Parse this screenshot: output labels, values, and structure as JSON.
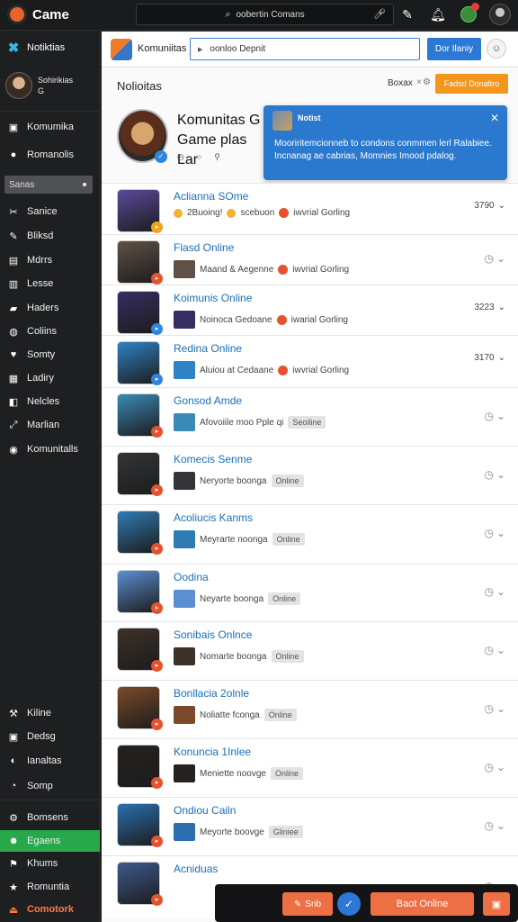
{
  "topbar": {
    "brand": "Came",
    "search_text": "oobertin Comans"
  },
  "sidebar": {
    "top_item": "Notiktias",
    "profile_name": "Sohirikias",
    "profile_sub": "G",
    "search_label": "Sanas",
    "items_a": [
      {
        "label": "Komumika",
        "icon": "home-icon"
      },
      {
        "label": "Romanolis",
        "icon": "globe-icon"
      }
    ],
    "items_b": [
      {
        "label": "Sanice",
        "icon": "tools-icon"
      },
      {
        "label": "Bliksd",
        "icon": "pencil-icon"
      },
      {
        "label": "Mdrrs",
        "icon": "video-icon"
      },
      {
        "label": "Lesse",
        "icon": "book-icon"
      },
      {
        "label": "Haders",
        "icon": "folder-icon"
      },
      {
        "label": "Coliins",
        "icon": "chat-icon"
      },
      {
        "label": "Somty",
        "icon": "heart-icon"
      },
      {
        "label": "Ladiry",
        "icon": "list-icon"
      },
      {
        "label": "Nelcles",
        "icon": "tag-icon"
      },
      {
        "label": "Marlian",
        "icon": "share-icon"
      },
      {
        "label": "Komunitalls",
        "icon": "circle-icon"
      }
    ],
    "items_c": [
      {
        "label": "Kiline",
        "icon": "wrench-icon"
      },
      {
        "label": "Dedsg",
        "icon": "calendar-icon"
      },
      {
        "label": "Ianaltas",
        "icon": "people-icon"
      },
      {
        "label": "Somp",
        "icon": "clock-icon"
      }
    ],
    "items_d": [
      {
        "label": "Bomsens",
        "icon": "gear-icon"
      },
      {
        "label": "Egaens",
        "icon": "user-icon"
      },
      {
        "label": "Khums",
        "icon": "flag-icon"
      },
      {
        "label": "Romuntia",
        "icon": "star-icon"
      },
      {
        "label": "Comotork",
        "icon": "exit-icon"
      }
    ]
  },
  "header": {
    "app_name": "Komuniitas",
    "url": "oonloo Depnit",
    "button": "Dor Ilaniy"
  },
  "section": {
    "title": "Nolioitas",
    "sort_label": "Boxax",
    "action_button": "Fadsd Donaltro"
  },
  "hero": {
    "title": "Komunitas G Game plas Lar"
  },
  "tooltip": {
    "title": "Notist",
    "body": "Mooriritemcionneb to condons conmmen lerl Ralabiee. Incnanag ae cabrias, Momnies Imood pdalog."
  },
  "rows": [
    {
      "name": "Aclianna SOme",
      "meta": "2Buoing!",
      "meta2": "scebuon",
      "tag": "iwvrial Gorling",
      "num": "3790",
      "thumb": "#5b4a9c"
    },
    {
      "name": "Flasd Online",
      "meta": "Maand & Aegenne",
      "tag": "iwvrial Gorling",
      "num": "",
      "thumb": "#5f5147"
    },
    {
      "name": "Koimunis Online",
      "meta": "Noinoca Gedoane",
      "tag": "iwarial Gorling",
      "num": "3223",
      "thumb": "#362e63"
    },
    {
      "name": "Redina Online",
      "meta": "Aluiou at Cedaane",
      "tag": "iwvrial Gorling",
      "num": "3170",
      "thumb": "#2e82c5"
    },
    {
      "name": "Gonsod Amde",
      "meta": "Afovoiile moo Pple qi",
      "chip": "Seoiline",
      "num": "",
      "thumb": "#3a8ab7"
    },
    {
      "name": "Komecis Senme",
      "meta": "Neryorte boonga",
      "chip": "Online",
      "num": "",
      "thumb": "#333538"
    },
    {
      "name": "Acoliucis Kanms",
      "meta": "Meyrarte noonga",
      "chip": "Online",
      "num": "",
      "thumb": "#2f7bb4"
    },
    {
      "name": "Oodina",
      "meta": "Neyarte boonga",
      "chip": "Online",
      "num": "",
      "thumb": "#5b8fd3"
    },
    {
      "name": "Sonibais Onlnce",
      "meta": "Nomarte boonga",
      "chip": "Online",
      "num": "",
      "thumb": "#3d3129"
    },
    {
      "name": "Bonllacia 2olnle",
      "meta": "Noliatte fconga",
      "chip": "Online",
      "num": "",
      "thumb": "#7c4a2a"
    },
    {
      "name": "Konuncia 1Inlee",
      "meta": "Meniette noovge",
      "chip": "Online",
      "num": "",
      "thumb": "#26211f"
    },
    {
      "name": "Ondiou Cailn",
      "meta": "Meyorte boovge",
      "chip": "Gliniee",
      "num": "",
      "thumb": "#2b6fb0"
    },
    {
      "name": "Acniduas",
      "meta": "",
      "chip": "",
      "num": "",
      "thumb": "#3e5a8e"
    }
  ],
  "float_bar": {
    "btn1": "Snb",
    "btn2": "Baot Online"
  },
  "colors": {
    "accent_blue": "#2c78d5",
    "accent_orange": "#f3961b",
    "link_blue": "#1a6fb7",
    "sidebar_bg": "#1e1f21",
    "active_green": "#27a84a"
  }
}
